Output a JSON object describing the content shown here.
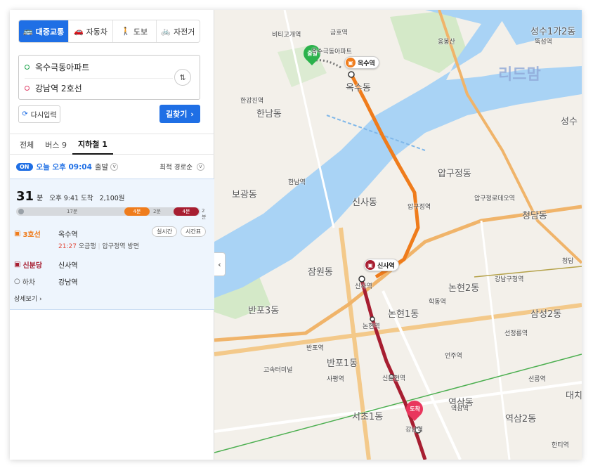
{
  "modes": [
    {
      "icon": "bus-icon",
      "glyph": "🚌",
      "label": "대중교통",
      "active": true
    },
    {
      "icon": "car-icon",
      "glyph": "🚗",
      "label": "자동차",
      "active": false
    },
    {
      "icon": "walk-icon",
      "glyph": "🚶",
      "label": "도보",
      "active": false
    },
    {
      "icon": "bike-icon",
      "glyph": "🚲",
      "label": "자전거",
      "active": false
    }
  ],
  "route": {
    "origin": "옥수극동아파트",
    "destination": "강남역 2호선",
    "swap_glyph": "⇅"
  },
  "actions": {
    "reset_label": "다시입력",
    "reset_glyph": "⟳",
    "search_label": "길찾기",
    "search_glyph": "›"
  },
  "tabs": [
    {
      "label": "전체",
      "active": false
    },
    {
      "label": "버스 9",
      "active": false
    },
    {
      "label": "지하철 1",
      "active": true
    }
  ],
  "options": {
    "on_badge": "ON",
    "departure": "오늘 오후 09:04",
    "departure_suffix": "출발",
    "sort": "최적 경로순"
  },
  "result": {
    "duration": "31",
    "duration_unit": "분",
    "arrival": "오후 9:41 도착",
    "fare": "2,100원",
    "bar": {
      "walk1_label": "17분",
      "line3_label": "4분",
      "transfer_label": "2분",
      "shinbundang_label": "4분",
      "walk2_label": "2분"
    },
    "steps": [
      {
        "line": "3호선",
        "line_color": "#ef7c1c",
        "station": "옥수역",
        "time": "21:27",
        "time_suffix": "오금행",
        "direction": "압구정역 방면",
        "pill1": "실시간",
        "pill2": "시간표"
      },
      {
        "line": "신분당",
        "line_color": "#a71e31",
        "station": "신사역"
      },
      {
        "line": "하차",
        "line_color": "#666666",
        "station": "강남역"
      }
    ],
    "detail_label": "상세보기 ›"
  },
  "map": {
    "collapse_glyph": "‹",
    "watermark": "리드맘",
    "start_pin": "출발",
    "end_pin": "도착",
    "tag_origin": "옥수역",
    "tag_transfer": "신사역",
    "labels": [
      {
        "t": "금호역"
      },
      {
        "t": "비티고개역"
      },
      {
        "t": "옥수극동아파트"
      },
      {
        "t": "응봉산"
      },
      {
        "t": "한남동"
      },
      {
        "t": "한남역"
      },
      {
        "t": "옥수동"
      },
      {
        "t": "압구정동"
      },
      {
        "t": "압구정역"
      },
      {
        "t": "압구정로데오역"
      },
      {
        "t": "청담동"
      },
      {
        "t": "신사동"
      },
      {
        "t": "신사역"
      },
      {
        "t": "잠원동"
      },
      {
        "t": "보광동"
      },
      {
        "t": "반포3동"
      },
      {
        "t": "반포1동"
      },
      {
        "t": "논현2동"
      },
      {
        "t": "논현1동"
      },
      {
        "t": "논현역"
      },
      {
        "t": "신논현역"
      },
      {
        "t": "강남역"
      },
      {
        "t": "역삼동"
      },
      {
        "t": "역삼2동"
      },
      {
        "t": "삼성2동"
      },
      {
        "t": "선정릉역"
      },
      {
        "t": "언주역"
      },
      {
        "t": "학동역"
      },
      {
        "t": "강남구청역"
      },
      {
        "t": "성수1가2동"
      },
      {
        "t": "한강진역"
      },
      {
        "t": "반포역"
      },
      {
        "t": "사평역"
      },
      {
        "t": "고속터미널"
      },
      {
        "t": "선릉역"
      },
      {
        "t": "역삼역"
      },
      {
        "t": "서초1동"
      },
      {
        "t": "한티역"
      },
      {
        "t": "뚝섬역"
      },
      {
        "t": "성수"
      },
      {
        "t": "청담"
      },
      {
        "t": "대치"
      }
    ]
  },
  "colors": {
    "accent": "#1f6fe5",
    "line3": "#ef7c1c",
    "shinbundang": "#a71e31",
    "river": "#a9d3f5",
    "park": "#cfe6c3"
  }
}
